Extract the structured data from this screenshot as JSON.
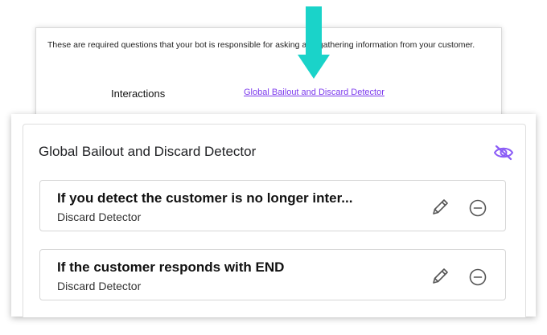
{
  "document": {
    "description": "These are required questions that your bot is responsible for asking and gathering information from your customer.",
    "interactions_label": "Interactions",
    "interactions_link": "Global Bailout and Discard Detector"
  },
  "panel": {
    "title": "Global Bailout and Discard Detector",
    "items": [
      {
        "title": "If you detect the customer is no longer inter...",
        "subtitle": "Discard Detector"
      },
      {
        "title": "If the customer responds with END",
        "subtitle": "Discard Detector"
      }
    ]
  },
  "colors": {
    "accent": "#7c3aed",
    "arrow": "#1ad3c9"
  }
}
